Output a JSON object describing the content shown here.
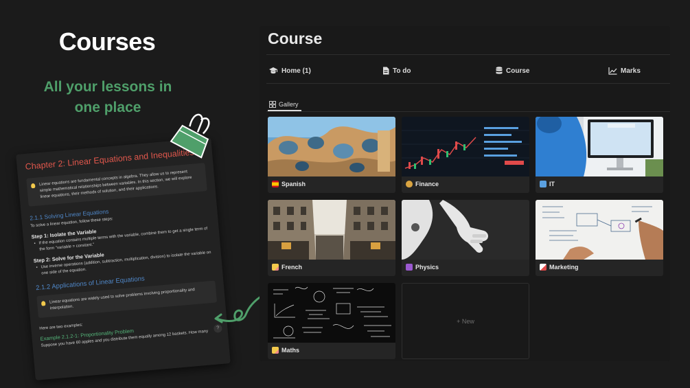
{
  "hero": {
    "title": "Courses",
    "subtitle": "All your lessons in one place"
  },
  "document": {
    "title": "Chapter 2: Linear Equations and Inequalities",
    "intro": "Linear equations are fundamental concepts in algebra. They allow us to represent simple mathematical relationships between variables. In this section, we will explore linear equations, their methods of solution, and their applications.",
    "section_1": "2.1.1 Solving Linear Equations",
    "section_1_text": "To solve a linear equation, follow these steps:",
    "step_1": "Step 1: Isolate the Variable",
    "step_1_text": "If the equation contains multiple terms with the variable, combine them to get a single term of the form \"variable = constant.\"",
    "step_2": "Step 2: Solve for the Variable",
    "step_2_text": "Use inverse operations (addition, subtraction, multiplication, division) to isolate the variable on one side of the equation.",
    "section_2": "2.1.2 Applications of Linear Equations",
    "callout_2": "Linear equations are widely used to solve problems involving proportionality and interpolation.",
    "examples_intro": "Here are two examples:",
    "example_title": "Example 2.1.2-1: Proportionality Problem",
    "example_text": "Suppose you have 60 apples and you distribute them equally among 12 baskets. How many",
    "help": "?"
  },
  "panel": {
    "title": "Course",
    "nav": [
      {
        "label": "Home (1)",
        "icon": "graduation-cap-icon"
      },
      {
        "label": "To do",
        "icon": "document-icon"
      },
      {
        "label": "Course",
        "icon": "database-icon"
      },
      {
        "label": "Marks",
        "icon": "line-chart-icon"
      }
    ],
    "view_tab": {
      "label": "Gallery",
      "icon": "gallery-icon"
    },
    "cards": [
      {
        "label": "Spanish",
        "icon": "spain-flag-icon",
        "image": "casa-batllo-image"
      },
      {
        "label": "Finance",
        "icon": "money-bag-icon",
        "image": "stock-chart-image"
      },
      {
        "label": "IT",
        "icon": "computer-icon",
        "image": "person-at-computer-image"
      },
      {
        "label": "French",
        "icon": "pencil-icon",
        "image": "paris-street-image"
      },
      {
        "label": "Physics",
        "icon": "atom-icon",
        "image": "robot-hand-image"
      },
      {
        "label": "Marketing",
        "icon": "chart-increasing-icon",
        "image": "whiteboard-image"
      },
      {
        "label": "Maths",
        "icon": "pencil-icon",
        "image": "chalkboard-formulas-image"
      }
    ],
    "new_label": "+ New"
  },
  "colors": {
    "background": "#1b1b1b",
    "panel": "#191919",
    "card": "#252525",
    "accent_green": "#4f9f6a",
    "doc_title_red": "#e0574c",
    "doc_link_blue": "#4f86c6"
  }
}
